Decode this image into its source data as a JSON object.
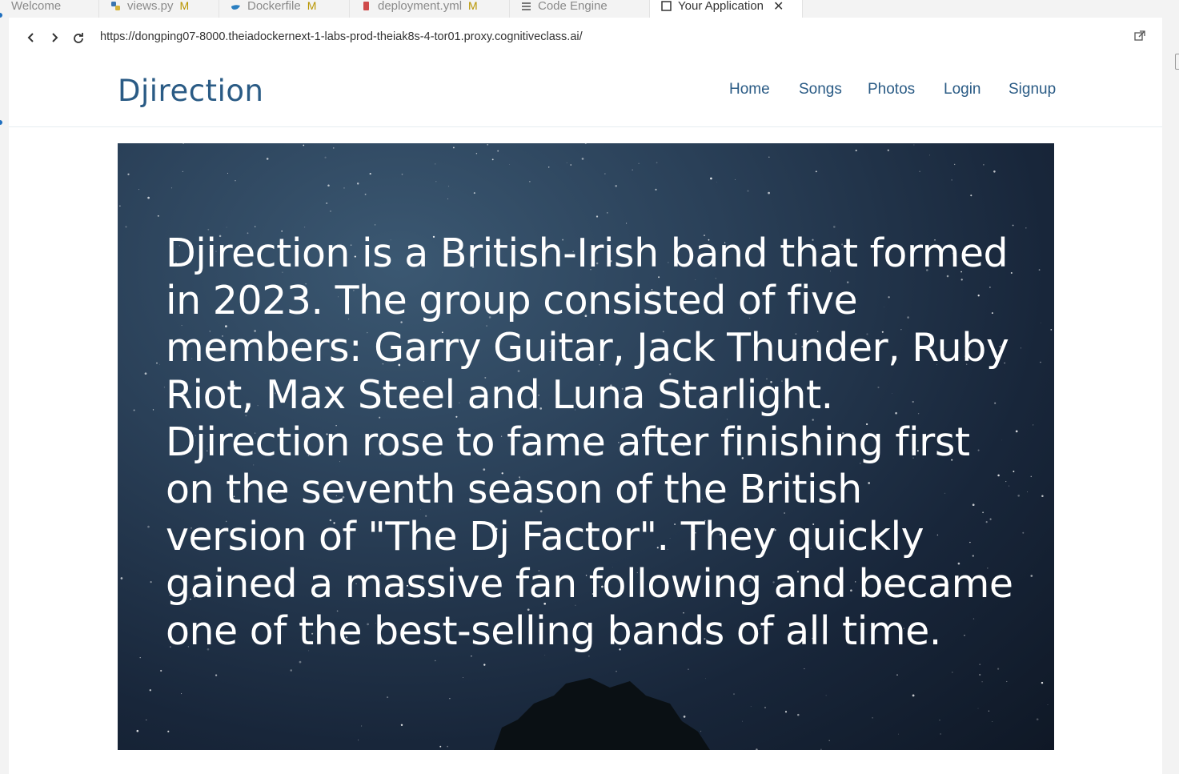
{
  "ide": {
    "tabs": [
      {
        "label": "Welcome",
        "modified": "",
        "icon": "info-icon"
      },
      {
        "label": "views.py",
        "modified": "M",
        "icon": "python-icon"
      },
      {
        "label": "Dockerfile",
        "modified": "M",
        "icon": "docker-icon"
      },
      {
        "label": "deployment.yml",
        "modified": "M",
        "icon": "yaml-icon"
      },
      {
        "label": "Code Engine",
        "modified": "",
        "icon": "stack-icon"
      },
      {
        "label": "Your Application",
        "modified": "",
        "icon": "window-icon",
        "close": "✕"
      }
    ]
  },
  "browser": {
    "back": "‹",
    "forward": "›",
    "reload": "⟳",
    "url": "https://dongping07-8000.theiadockernext-1-labs-prod-theiak8s-4-tor01.proxy.cognitiveclass.ai/"
  },
  "site": {
    "brand": "Djirection",
    "nav": [
      "Home",
      "Songs",
      "Photos",
      "Login",
      "Signup"
    ],
    "hero_text": "Djirection is a British-Irish band that formed in 2023. The group consisted of five members: Garry Guitar, Jack Thunder, Ruby Riot, Max Steel and Luna Starlight. Djirection rose to fame after finishing first on the seventh season of the British version of \"The Dj Factor\". They quickly gained a massive fan following and became one of the best-selling bands of all time."
  },
  "colors": {
    "brand": "#2a5b85",
    "modified": "#b89500",
    "hero_bg": "#1a2a3e"
  }
}
